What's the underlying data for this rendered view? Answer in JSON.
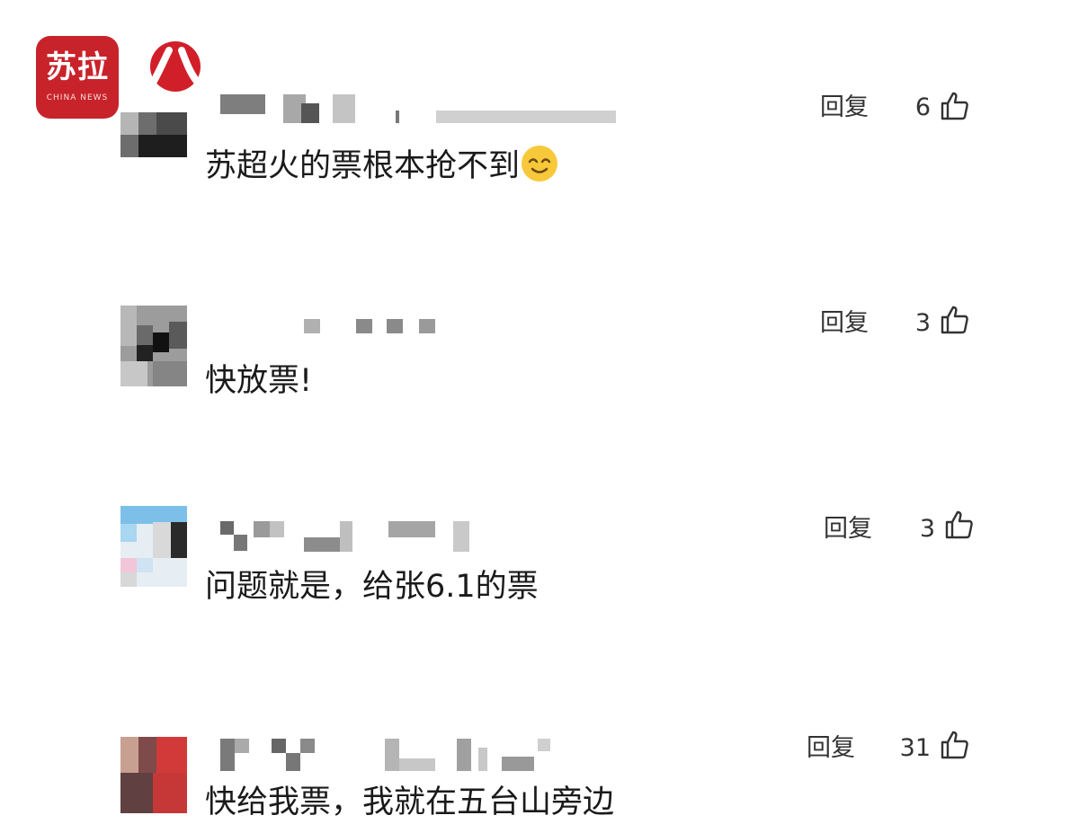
{
  "logos": {
    "app_name": "苏拉",
    "app_name_en": "CHINA NEWS"
  },
  "reply_label": "回复",
  "comments": [
    {
      "text": "苏超火的票根本抢不到",
      "emoji": "smiling-emoji",
      "likes": "6"
    },
    {
      "text": "快放票!",
      "likes": "3"
    },
    {
      "text": "问题就是，给张6.1的票",
      "likes": "3"
    },
    {
      "text": "快给我票，我就在五台山旁边",
      "likes": "31"
    }
  ],
  "icons": {
    "like": "thumbs-up-icon"
  },
  "colors": {
    "logo_red": "#c8232a",
    "text": "#1a1a1a",
    "meta": "#333333"
  }
}
